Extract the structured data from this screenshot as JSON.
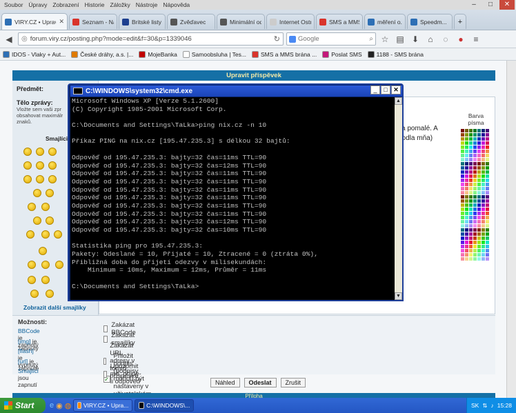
{
  "menubar": {
    "items": [
      "Soubor",
      "Úpravy",
      "Zobrazení",
      "Historie",
      "Záložky",
      "Nástroje",
      "Nápověda"
    ]
  },
  "tabs": [
    {
      "label": "VIRY.CZ • Upravit",
      "color": "#2d6fb5",
      "active": true
    },
    {
      "label": "Seznam - Najdu tam,",
      "color": "#d9342b"
    },
    {
      "label": "Britské listy",
      "color": "#1d3f8f"
    },
    {
      "label": "Zvěďavec",
      "color": "#555555"
    },
    {
      "label": "Minimální odpočinek",
      "color": "#555555"
    },
    {
      "label": "Internet Ostrava",
      "color": "#cccccc"
    },
    {
      "label": "SMS a MMS brána",
      "color": "#d9342b"
    },
    {
      "label": "měření o...",
      "color": "#2d6fb5"
    },
    {
      "label": "Speedm...",
      "color": "#2d6fb5"
    }
  ],
  "nav": {
    "url": "forum.viry.cz/posting.php?mode=edit&f=30&p=1339046",
    "search_placeholder": "Google"
  },
  "bookmarks": [
    {
      "label": "IDOS - Vlaky + Aut...",
      "color": "#2d6fb5"
    },
    {
      "label": "České dráhy, a.s. |...",
      "color": "#e07a00"
    },
    {
      "label": "MojeBanka",
      "color": "#c00000"
    },
    {
      "label": "Samoobsluha | Tes...",
      "color": "#ffffff"
    },
    {
      "label": "SMS a MMS brána ...",
      "color": "#d9342b"
    },
    {
      "label": "Poslat SMS",
      "color": "#c4197a"
    },
    {
      "label": "1188 - SMS brána",
      "color": "#222222"
    }
  ],
  "page": {
    "banner": "Upravit příspěvek",
    "subject_label": "Předmět:",
    "body_label": "Tělo zprávy:",
    "body_help": [
      "Vložte sem vaši zpr",
      "obsahovat maximálr",
      "znaků."
    ],
    "smilies_title": "Smajlíci",
    "more_smilies": "Zobrazit další smajlíky",
    "textarea_text": [
      "va pomalé. A",
      "podla mňa)"
    ],
    "palette_label": [
      "Barva",
      "písma"
    ],
    "options_title": "Možnosti:",
    "options_left": [
      {
        "link": "BBCode",
        "rest": "je zapnutý"
      },
      {
        "link": "[img]",
        "rest": "je zapnutý"
      },
      {
        "link": "[flash]",
        "rest": "je vypnutý"
      },
      {
        "link": "[url]",
        "rest": "je zapnuté"
      },
      {
        "link": "Smajlíci",
        "rest": "jsou zapnutí"
      }
    ],
    "checkboxes": [
      {
        "label": "Zakázat BBCode",
        "checked": false
      },
      {
        "label": "Zakázat smajlíky",
        "checked": false
      },
      {
        "label": "Zakázat URL adresy v tomto příspěvku",
        "checked": false
      },
      {
        "label": "Přiložit podpis (podpisy mohou být nastaveny v uživatelském panelu)",
        "checked": true
      },
      {
        "label": "Upozornit mě, přijde-li odpověď",
        "checked": false
      }
    ],
    "buttons": {
      "preview": "Náhled",
      "submit": "Odeslat",
      "cancel": "Zrušit"
    },
    "attachment": "Příloha"
  },
  "cmd": {
    "title": "C:\\WINDOWS\\system32\\cmd.exe",
    "lines": [
      "Microsoft Windows XP [Verze 5.1.2600]",
      "(C) Copyright 1985-2001 Microsoft Corp.",
      "",
      "C:\\Documents and Settings\\TaLka>ping nix.cz -n 10",
      "",
      "Příkaz PING na nix.cz [195.47.235.3] s délkou 32 bajtů:",
      "",
      "Odpověď od 195.47.235.3: bajty=32 čas=11ms TTL=90",
      "Odpověď od 195.47.235.3: bajty=32 čas=12ms TTL=90",
      "Odpověď od 195.47.235.3: bajty=32 čas=11ms TTL=90",
      "Odpověď od 195.47.235.3: bajty=32 čas=11ms TTL=90",
      "Odpověď od 195.47.235.3: bajty=32 čas=11ms TTL=90",
      "Odpověď od 195.47.235.3: bajty=32 čas=11ms TTL=90",
      "Odpověď od 195.47.235.3: bajty=32 čas=11ms TTL=90",
      "Odpověď od 195.47.235.3: bajty=32 čas=11ms TTL=90",
      "Odpověď od 195.47.235.3: bajty=32 čas=12ms TTL=90",
      "Odpověď od 195.47.235.3: bajty=32 čas=10ms TTL=90",
      "",
      "Statistika ping pro 195.47.235.3:",
      "Pakety: Odeslané = 10, Přijaté = 10, Ztracené = 0 (ztráta 0%),",
      "Přibližná doba do přijetí odezvy v milisekundách:",
      "    Minimum = 10ms, Maximum = 12ms, Průměr = 11ms",
      "",
      "C:\\Documents and Settings\\TaLka>"
    ]
  },
  "taskbar": {
    "start": "Start",
    "items": [
      {
        "label": "VIRY.CZ • Upra...",
        "color": "#3a6fd8"
      },
      {
        "label": "C:\\WINDOWS\\...",
        "color": "#1e4fb0"
      }
    ],
    "lang": "SK",
    "clock": "15:28"
  }
}
